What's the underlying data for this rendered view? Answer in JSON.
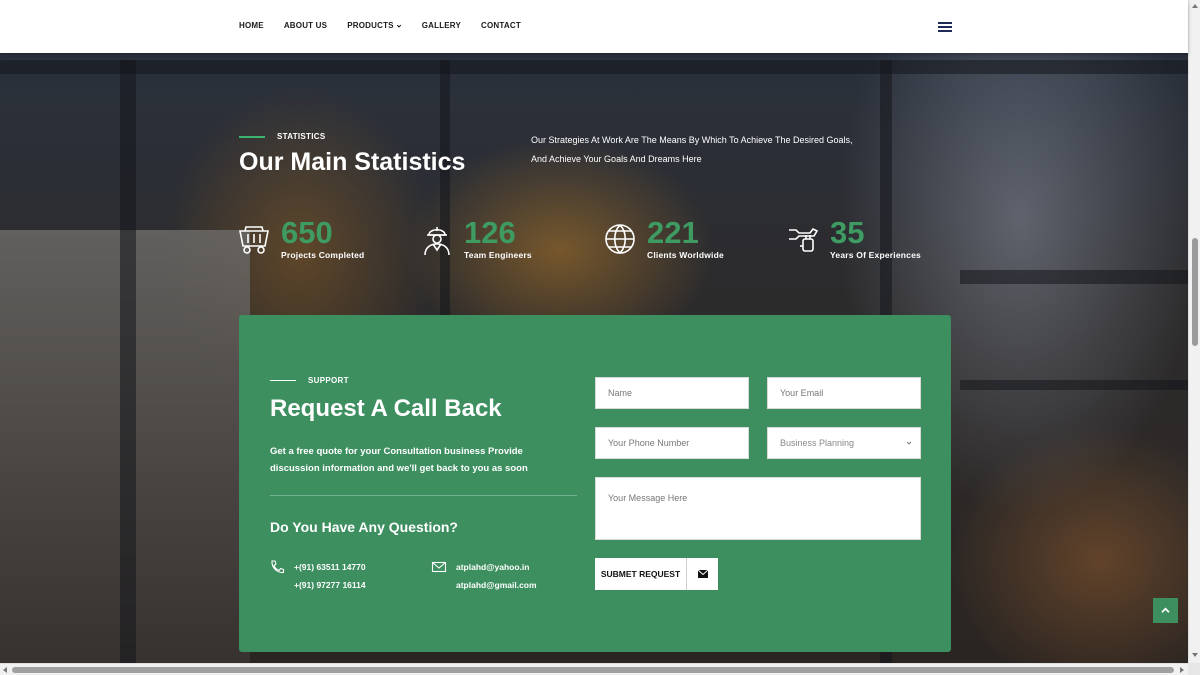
{
  "nav": {
    "items": [
      {
        "label": "HOME"
      },
      {
        "label": "ABOUT US"
      },
      {
        "label": "PRODUCTS"
      },
      {
        "label": "GALLERY"
      },
      {
        "label": "CONTACT"
      }
    ],
    "menu_icon": "hamburger-menu-icon"
  },
  "statistics": {
    "eyebrow": "STATISTICS",
    "title": "Our Main Statistics",
    "description": "Our Strategies At Work Are The Means By Which To Achieve The Desired Goals, And Achieve Your Goals And Dreams Here",
    "items": [
      {
        "value": "650",
        "label": "Projects Completed",
        "icon": "mine-cart-icon"
      },
      {
        "value": "126",
        "label": "Team Engineers",
        "icon": "engineer-icon"
      },
      {
        "value": "221",
        "label": "Clients Worldwide",
        "icon": "globe-icon"
      },
      {
        "value": "35",
        "label": "Years Of Experiences",
        "icon": "tools-icon"
      }
    ]
  },
  "callback": {
    "eyebrow": "SUPPORT",
    "title": "Request A Call Back",
    "description": "Get a free quote for your Consultation business Provide discussion information and we'll get back to you as soon",
    "question": "Do You Have Any Question?",
    "phones": [
      "+(91) 63511 14770",
      "+(91) 97277 16114"
    ],
    "emails": [
      "atplahd@yahoo.in",
      "atplahd@gmail.com"
    ],
    "form": {
      "name_placeholder": "Name",
      "email_placeholder": "Your Email",
      "phone_placeholder": "Your Phone Number",
      "service_selected": "Business Planning",
      "message_placeholder": "Your Message Here",
      "submit_label": "SUBMET REQUEST"
    }
  },
  "colors": {
    "accent": "#3d8f60",
    "stat_number": "#3e9b62",
    "header_bg": "#ffffff"
  }
}
